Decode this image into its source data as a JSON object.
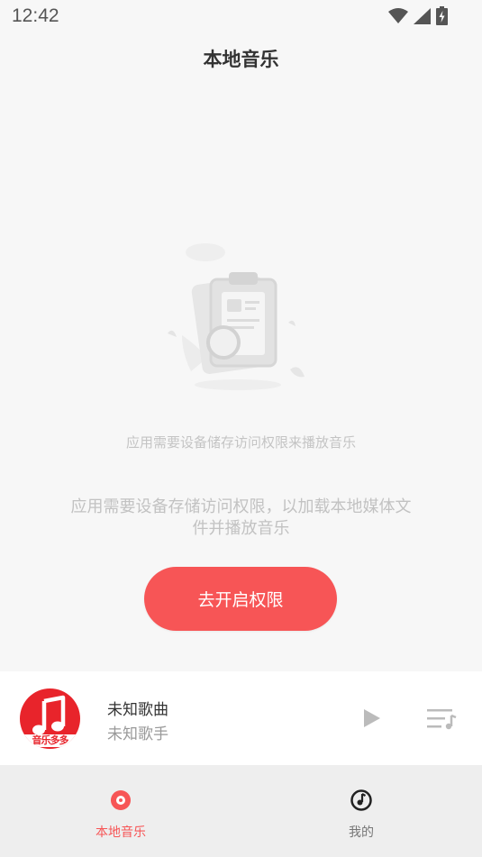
{
  "status_bar": {
    "time": "12:42",
    "icons": [
      "wifi-icon",
      "signal-icon",
      "battery-icon"
    ]
  },
  "header": {
    "title": "本地音乐"
  },
  "empty_state": {
    "illustration": "clipboard-illustration",
    "caption": "应用需要设备储存访问权限来播放音乐"
  },
  "permission": {
    "description": "应用需要设备存储访问权限，以加载本地媒体文件并播放音乐",
    "button_label": "去开启权限"
  },
  "player": {
    "album_text": "音乐多多",
    "song_title": "未知歌曲",
    "artist": "未知歌手",
    "icons": [
      "play-icon",
      "playlist-icon"
    ]
  },
  "bottom_nav": {
    "items": [
      {
        "label": "本地音乐",
        "icon": "disc-icon",
        "active": true
      },
      {
        "label": "我的",
        "icon": "music-note-icon",
        "active": false
      }
    ]
  },
  "colors": {
    "accent": "#f75556",
    "album_red": "#e8242b",
    "background": "#f7f7f7",
    "nav_background": "#eeeeee"
  }
}
